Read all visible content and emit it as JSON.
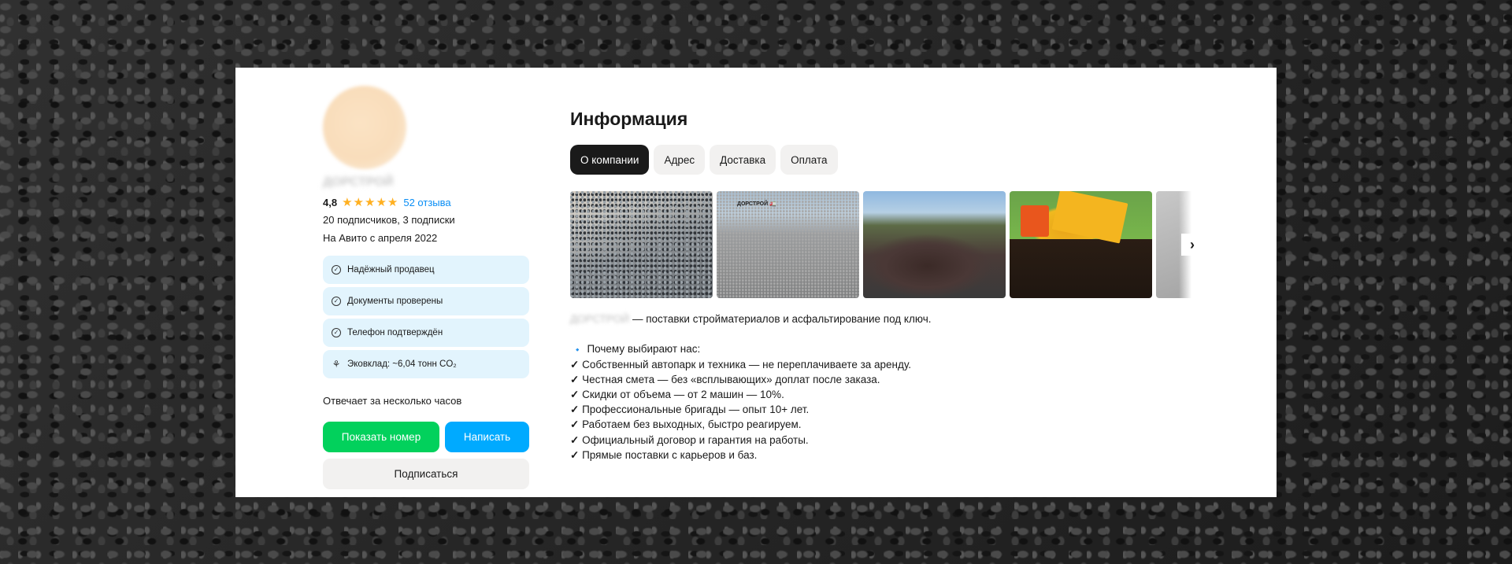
{
  "profile": {
    "name": "ДОРСТРОЙ",
    "rating": "4,8",
    "stars": 5,
    "reviews": "52 отзыва",
    "followers": "20 подписчиков, 3 подписки",
    "since": "На Авито с апреля 2022",
    "badges": [
      {
        "icon": "check-circle-icon",
        "label": "Надёжный продавец"
      },
      {
        "icon": "check-circle-icon",
        "label": "Документы проверены"
      },
      {
        "icon": "check-circle-icon",
        "label": "Телефон подтверждён"
      },
      {
        "icon": "eco-trophy-icon",
        "label": "Эковклад: ~6,04 тонн CO₂"
      }
    ],
    "responds": "Отвечает за несколько часов",
    "buttons": {
      "show_phone": "Показать номер",
      "write": "Написать",
      "subscribe": "Подписаться"
    }
  },
  "info": {
    "title": "Информация",
    "tabs": [
      "О компании",
      "Адрес",
      "Доставка",
      "Оплата"
    ],
    "active_tab": 0,
    "gallery": {
      "photos": [
        "gravel-photo",
        "gravel-pile-photo",
        "soil-pile-photo",
        "dump-truck-photo",
        "photo-5"
      ],
      "photo_2_label": "ДОРСТРОЙ 🚛",
      "next_icon": "chevron-right-icon"
    },
    "description": {
      "intro_name": "ДОРСТРОЙ",
      "intro_text": "— поставки стройматериалов и асфальтирование под ключ.",
      "why_icon": "🔹",
      "why_title": "Почему выбирают нас:",
      "check": "✓",
      "points": [
        "Собственный автопарк и техника — не переплачиваете за аренду.",
        "Честная смета — без «всплывающих» доплат после заказа.",
        "Скидки от объема — от 2 машин — 10%.",
        "Профессиональные бригады — опыт 10+ лет.",
        "Работаем без выходных, быстро реагируем.",
        "Официальный договор и гарантия на работы.",
        "Прямые поставки с карьеров и баз."
      ]
    }
  },
  "colors": {
    "accent_green": "#02d15c",
    "accent_blue": "#00aaff",
    "link": "#0a8ef5",
    "star": "#ffb021",
    "badge_bg": "#e2f4fd"
  }
}
